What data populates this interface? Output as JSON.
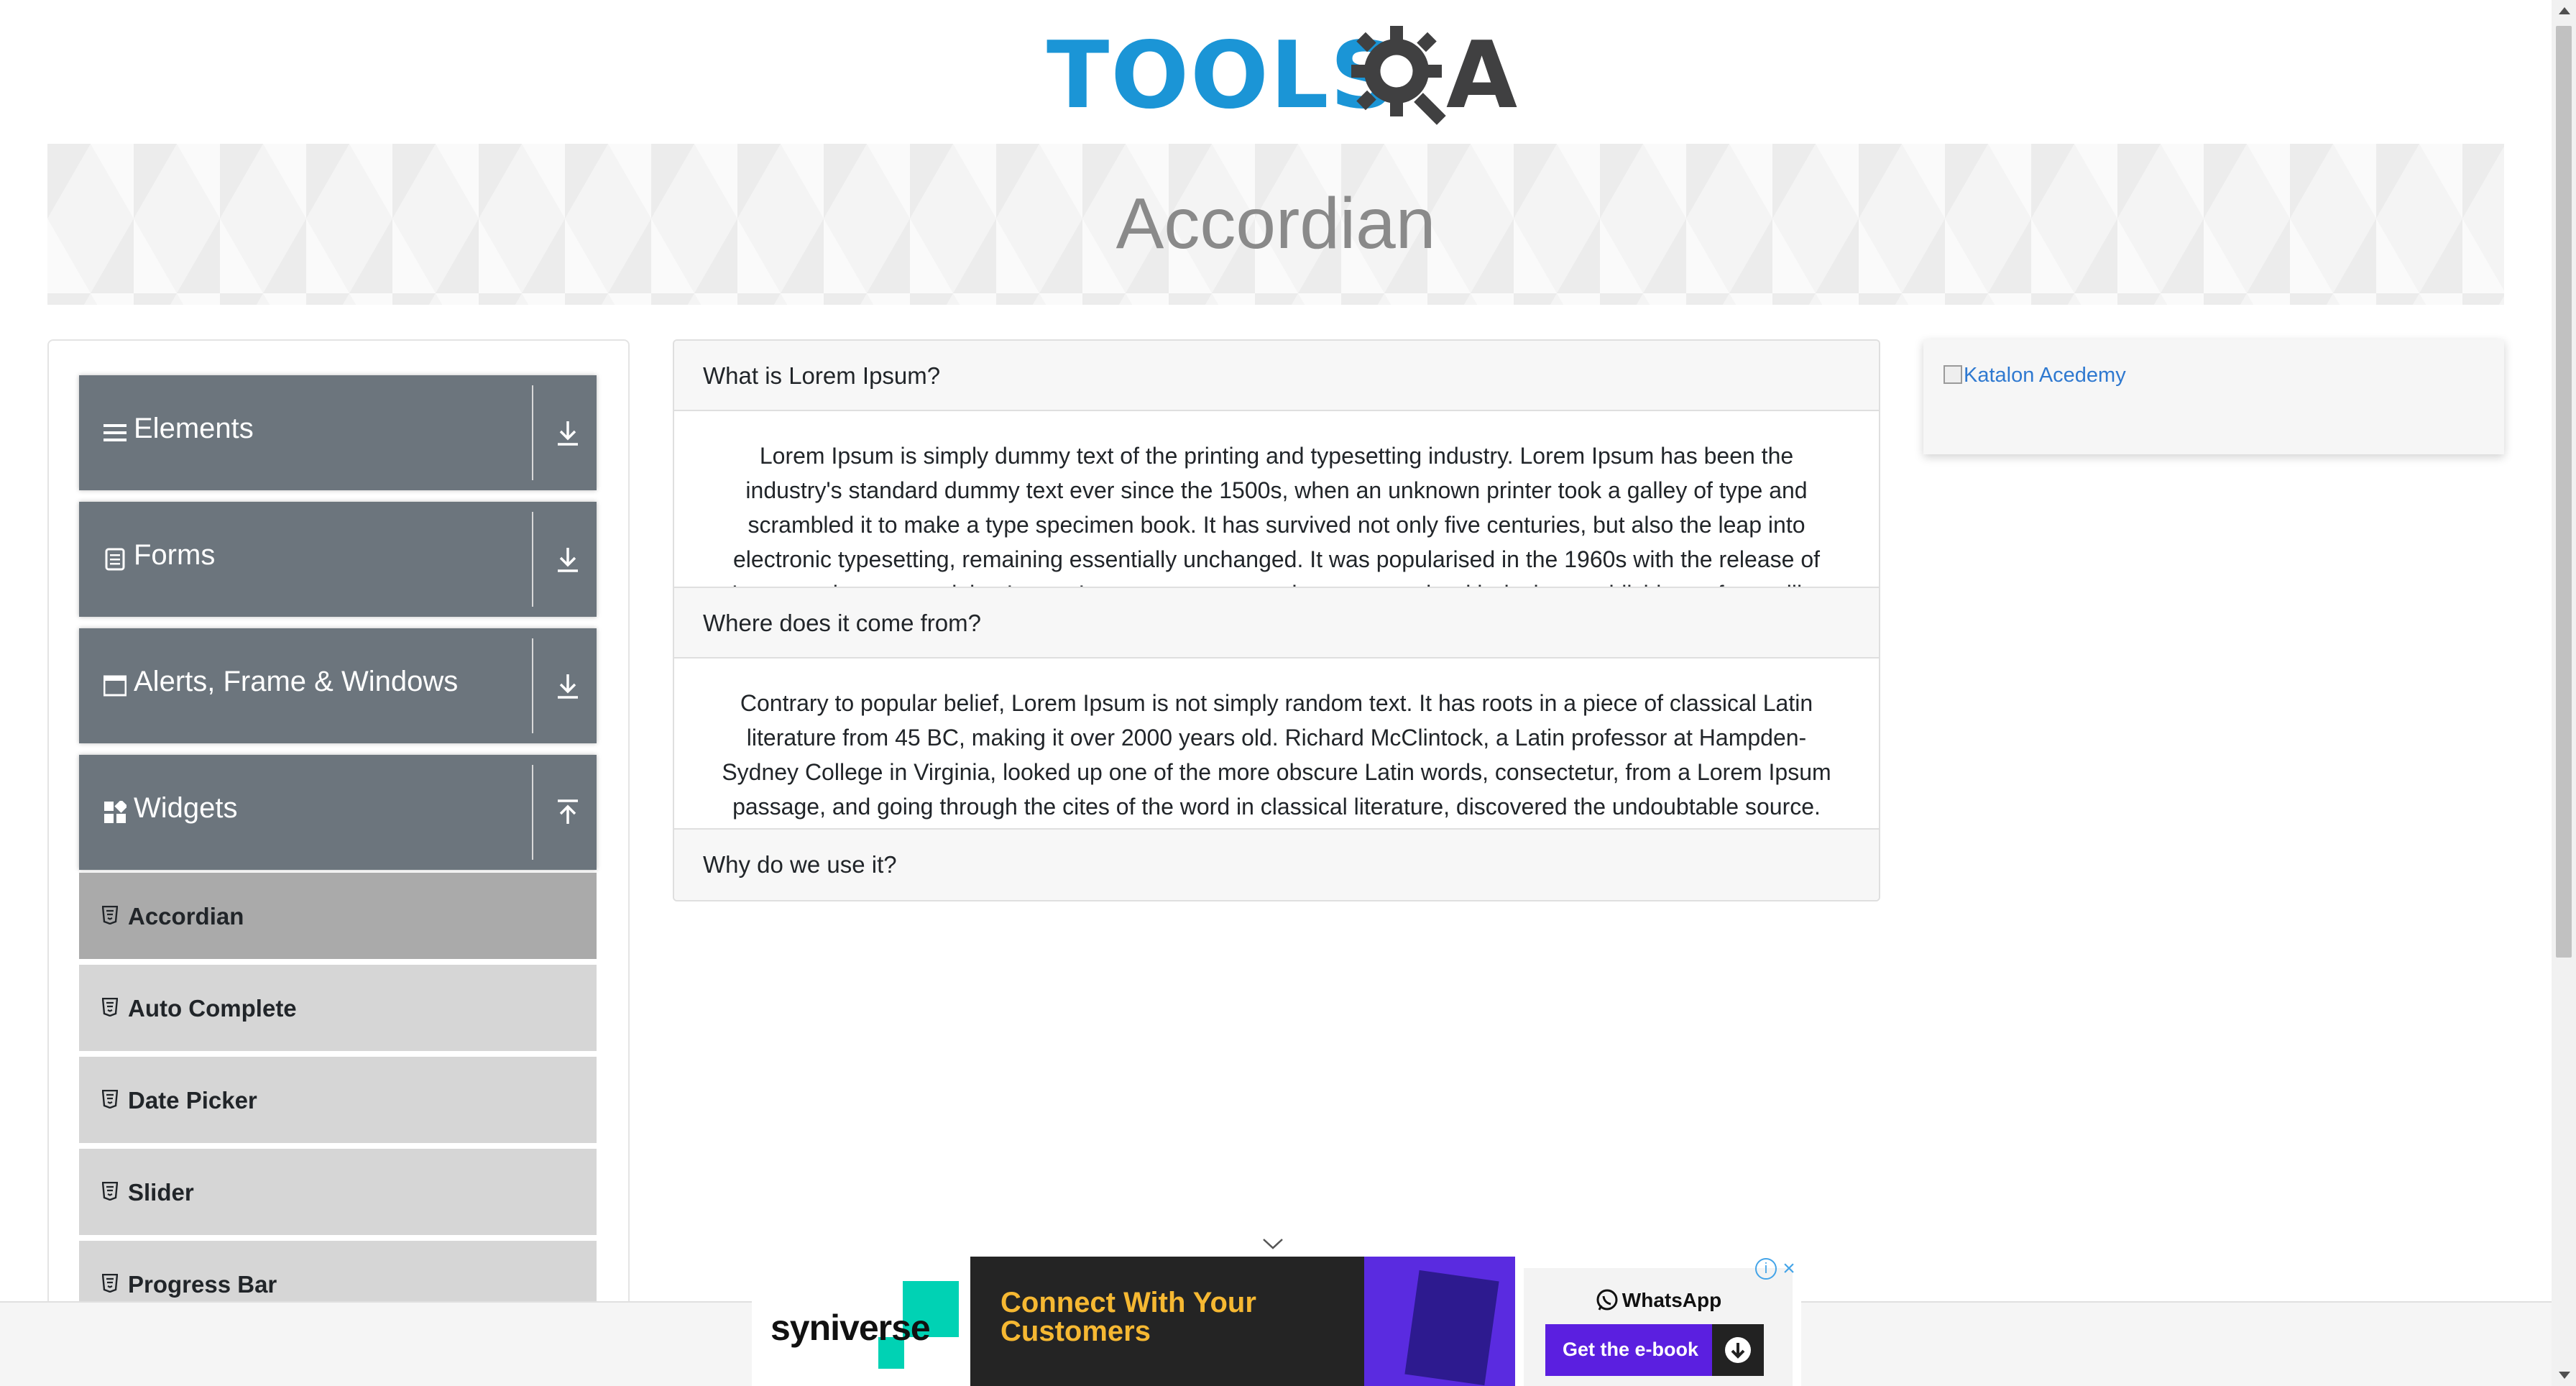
{
  "header": {
    "logo_text": "TOOLS",
    "logo_letter": "A"
  },
  "banner": {
    "title": "Accordian"
  },
  "sidebar": {
    "groups": [
      {
        "label": "Elements",
        "icon": "hamburger-icon",
        "expanded": false
      },
      {
        "label": "Forms",
        "icon": "document-icon",
        "expanded": false
      },
      {
        "label": "Alerts, Frame & Windows",
        "icon": "window-icon",
        "expanded": false
      },
      {
        "label": "Widgets",
        "icon": "grid-icon",
        "expanded": true
      }
    ],
    "widget_items": [
      {
        "label": "Accordian",
        "active": true
      },
      {
        "label": "Auto Complete",
        "active": false
      },
      {
        "label": "Date Picker",
        "active": false
      },
      {
        "label": "Slider",
        "active": false
      },
      {
        "label": "Progress Bar",
        "active": false
      }
    ]
  },
  "accordion": {
    "sections": [
      {
        "heading": "What is Lorem Ipsum?",
        "body": "Lorem Ipsum is simply dummy text of the printing and typesetting industry. Lorem Ipsum has been the industry's standard dummy text ever since the 1500s, when an unknown printer took a galley of type and scrambled it to make a type specimen book. It has survived not only five centuries, but also the leap into electronic typesetting, remaining essentially unchanged. It was popularised in the 1960s with the release of Letraset sheets containing Lorem Ipsum passages, and more recently with desktop publishing software like Aldus PageMaker including versions of Lorem Ipsum."
      },
      {
        "heading": "Where does it come from?",
        "body": "Contrary to popular belief, Lorem Ipsum is not simply random text. It has roots in a piece of classical Latin literature from 45 BC, making it over 2000 years old. Richard McClintock, a Latin professor at Hampden-Sydney College in Virginia, looked up one of the more obscure Latin words, consectetur, from a Lorem Ipsum passage, and going through the cites of the word in classical literature, discovered the undoubtable source. Lorem Ipsum"
      },
      {
        "heading": "Why do we use it?",
        "body": ""
      }
    ]
  },
  "side_ad": {
    "alt_text": "Katalon Acedemy"
  },
  "bottom_ad": {
    "brand": "syniverse",
    "headline_line1": "Connect With Your",
    "headline_line2": "Customers",
    "whatsapp_label": "WhatsApp",
    "cta_label": "Get the e-book"
  },
  "colors": {
    "brand_blue": "#1b95d6",
    "sidebar_group_bg": "#6c757d",
    "menu_item_bg": "#d6d6d6",
    "menu_item_active_bg": "#aaaaaa",
    "ad_accent": "#f6b832",
    "ad_purple": "#5b1fe0"
  }
}
